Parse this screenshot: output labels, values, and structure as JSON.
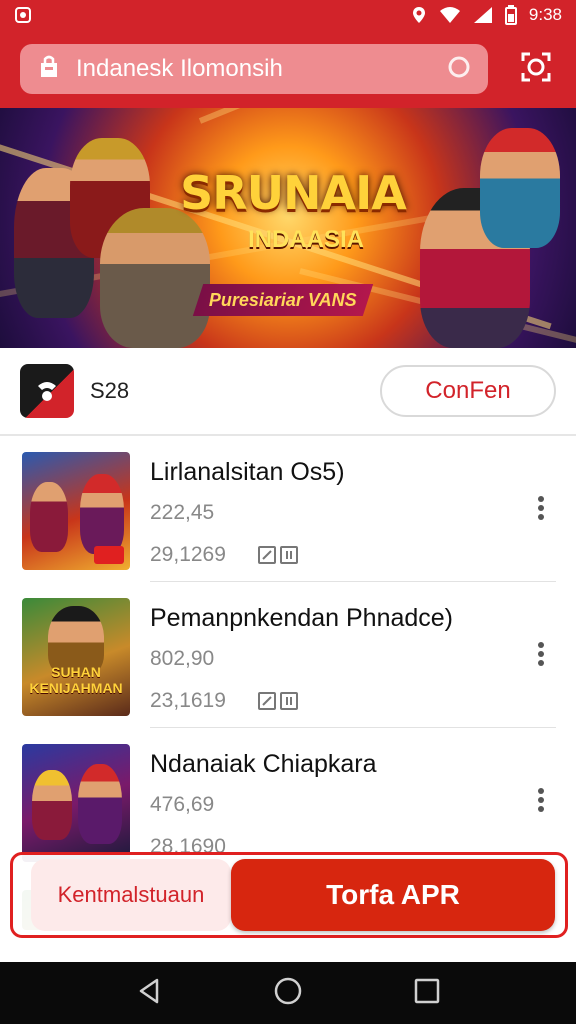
{
  "status_bar": {
    "time": "9:38",
    "icons": [
      "app-notification-icon",
      "location-icon",
      "wifi-icon",
      "signal-icon",
      "battery-icon"
    ]
  },
  "header": {
    "search_label": "Indanesk Ilomonsih",
    "icons": [
      "store-bag-icon",
      "voice-search-icon",
      "scan-icon"
    ]
  },
  "banner": {
    "title": "SRUNAIA",
    "subtitle": "INDAASIA",
    "ribbon": "Puresiariar VANS"
  },
  "developer": {
    "name": "S28",
    "button_label": "ConFen"
  },
  "apps": [
    {
      "title": "Lirlanalsitan Os5)",
      "size": "222,45",
      "date": "29,1269",
      "thumb_caption": ""
    },
    {
      "title": "Pemanpnkendan Phnadce)",
      "size": "802,90",
      "date": "23,1619",
      "thumb_caption": "SUHAN KENIJAHMAN"
    },
    {
      "title": "Ndanaiak Chiapkara",
      "size": "476,69",
      "date": "28,1690",
      "thumb_caption": ""
    }
  ],
  "action_bar": {
    "secondary_label": "Kentmalstuaun",
    "primary_label": "Torfa APR"
  },
  "nav": [
    "back-icon",
    "home-icon",
    "recents-icon"
  ],
  "colors": {
    "brand_red": "#d2232a",
    "primary_button": "#d7260f",
    "nav_bar": "#0a0a0a"
  }
}
